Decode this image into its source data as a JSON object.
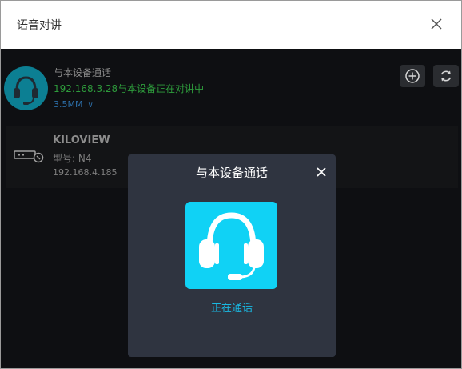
{
  "header": {
    "title": "语音对讲"
  },
  "device": {
    "name": "与本设备通话",
    "status": "192.168.3.28与本设备正在对讲中",
    "port": "3.5MM"
  },
  "card": {
    "brand": "KILOVIEW",
    "model": "型号: N4",
    "ip": "192.168.4.185"
  },
  "modal": {
    "title": "与本设备通话",
    "status": "正在通话"
  },
  "icons": {
    "header_close": "close-icon",
    "add": "plus-circle-icon",
    "refresh": "refresh-icon",
    "device": "encoder-device-icon",
    "headset": "headset-icon",
    "dropdown": "chevron-down-icon"
  },
  "colors": {
    "background": "#0e0f12",
    "modal": "#2f3440",
    "accent": "#10d2f5",
    "status_text": "#2e9c3c",
    "port_link": "#2c6ea8"
  }
}
